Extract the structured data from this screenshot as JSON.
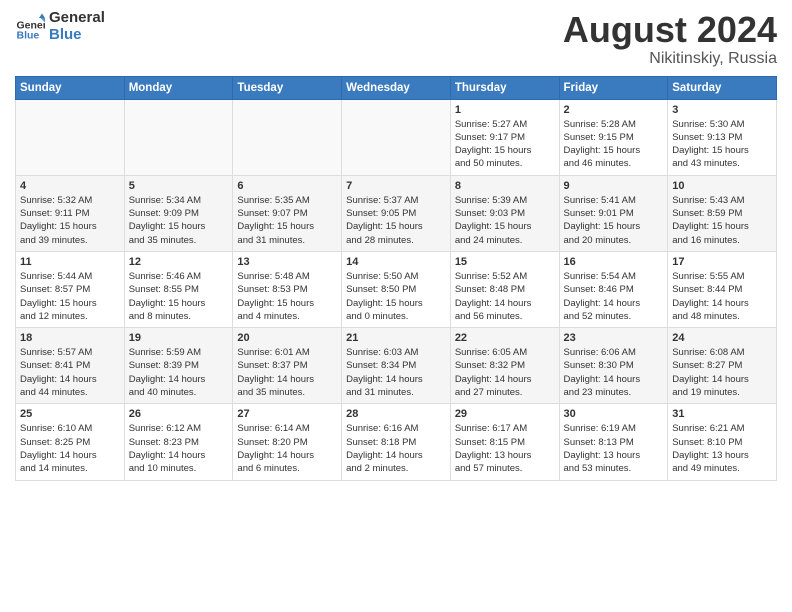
{
  "header": {
    "logo_general": "General",
    "logo_blue": "Blue",
    "month_title": "August 2024",
    "subtitle": "Nikitinskiy, Russia"
  },
  "days_of_week": [
    "Sunday",
    "Monday",
    "Tuesday",
    "Wednesday",
    "Thursday",
    "Friday",
    "Saturday"
  ],
  "weeks": [
    [
      {
        "day": "",
        "info": ""
      },
      {
        "day": "",
        "info": ""
      },
      {
        "day": "",
        "info": ""
      },
      {
        "day": "",
        "info": ""
      },
      {
        "day": "1",
        "info": "Sunrise: 5:27 AM\nSunset: 9:17 PM\nDaylight: 15 hours\nand 50 minutes."
      },
      {
        "day": "2",
        "info": "Sunrise: 5:28 AM\nSunset: 9:15 PM\nDaylight: 15 hours\nand 46 minutes."
      },
      {
        "day": "3",
        "info": "Sunrise: 5:30 AM\nSunset: 9:13 PM\nDaylight: 15 hours\nand 43 minutes."
      }
    ],
    [
      {
        "day": "4",
        "info": "Sunrise: 5:32 AM\nSunset: 9:11 PM\nDaylight: 15 hours\nand 39 minutes."
      },
      {
        "day": "5",
        "info": "Sunrise: 5:34 AM\nSunset: 9:09 PM\nDaylight: 15 hours\nand 35 minutes."
      },
      {
        "day": "6",
        "info": "Sunrise: 5:35 AM\nSunset: 9:07 PM\nDaylight: 15 hours\nand 31 minutes."
      },
      {
        "day": "7",
        "info": "Sunrise: 5:37 AM\nSunset: 9:05 PM\nDaylight: 15 hours\nand 28 minutes."
      },
      {
        "day": "8",
        "info": "Sunrise: 5:39 AM\nSunset: 9:03 PM\nDaylight: 15 hours\nand 24 minutes."
      },
      {
        "day": "9",
        "info": "Sunrise: 5:41 AM\nSunset: 9:01 PM\nDaylight: 15 hours\nand 20 minutes."
      },
      {
        "day": "10",
        "info": "Sunrise: 5:43 AM\nSunset: 8:59 PM\nDaylight: 15 hours\nand 16 minutes."
      }
    ],
    [
      {
        "day": "11",
        "info": "Sunrise: 5:44 AM\nSunset: 8:57 PM\nDaylight: 15 hours\nand 12 minutes."
      },
      {
        "day": "12",
        "info": "Sunrise: 5:46 AM\nSunset: 8:55 PM\nDaylight: 15 hours\nand 8 minutes."
      },
      {
        "day": "13",
        "info": "Sunrise: 5:48 AM\nSunset: 8:53 PM\nDaylight: 15 hours\nand 4 minutes."
      },
      {
        "day": "14",
        "info": "Sunrise: 5:50 AM\nSunset: 8:50 PM\nDaylight: 15 hours\nand 0 minutes."
      },
      {
        "day": "15",
        "info": "Sunrise: 5:52 AM\nSunset: 8:48 PM\nDaylight: 14 hours\nand 56 minutes."
      },
      {
        "day": "16",
        "info": "Sunrise: 5:54 AM\nSunset: 8:46 PM\nDaylight: 14 hours\nand 52 minutes."
      },
      {
        "day": "17",
        "info": "Sunrise: 5:55 AM\nSunset: 8:44 PM\nDaylight: 14 hours\nand 48 minutes."
      }
    ],
    [
      {
        "day": "18",
        "info": "Sunrise: 5:57 AM\nSunset: 8:41 PM\nDaylight: 14 hours\nand 44 minutes."
      },
      {
        "day": "19",
        "info": "Sunrise: 5:59 AM\nSunset: 8:39 PM\nDaylight: 14 hours\nand 40 minutes."
      },
      {
        "day": "20",
        "info": "Sunrise: 6:01 AM\nSunset: 8:37 PM\nDaylight: 14 hours\nand 35 minutes."
      },
      {
        "day": "21",
        "info": "Sunrise: 6:03 AM\nSunset: 8:34 PM\nDaylight: 14 hours\nand 31 minutes."
      },
      {
        "day": "22",
        "info": "Sunrise: 6:05 AM\nSunset: 8:32 PM\nDaylight: 14 hours\nand 27 minutes."
      },
      {
        "day": "23",
        "info": "Sunrise: 6:06 AM\nSunset: 8:30 PM\nDaylight: 14 hours\nand 23 minutes."
      },
      {
        "day": "24",
        "info": "Sunrise: 6:08 AM\nSunset: 8:27 PM\nDaylight: 14 hours\nand 19 minutes."
      }
    ],
    [
      {
        "day": "25",
        "info": "Sunrise: 6:10 AM\nSunset: 8:25 PM\nDaylight: 14 hours\nand 14 minutes."
      },
      {
        "day": "26",
        "info": "Sunrise: 6:12 AM\nSunset: 8:23 PM\nDaylight: 14 hours\nand 10 minutes."
      },
      {
        "day": "27",
        "info": "Sunrise: 6:14 AM\nSunset: 8:20 PM\nDaylight: 14 hours\nand 6 minutes."
      },
      {
        "day": "28",
        "info": "Sunrise: 6:16 AM\nSunset: 8:18 PM\nDaylight: 14 hours\nand 2 minutes."
      },
      {
        "day": "29",
        "info": "Sunrise: 6:17 AM\nSunset: 8:15 PM\nDaylight: 13 hours\nand 57 minutes."
      },
      {
        "day": "30",
        "info": "Sunrise: 6:19 AM\nSunset: 8:13 PM\nDaylight: 13 hours\nand 53 minutes."
      },
      {
        "day": "31",
        "info": "Sunrise: 6:21 AM\nSunset: 8:10 PM\nDaylight: 13 hours\nand 49 minutes."
      }
    ]
  ]
}
